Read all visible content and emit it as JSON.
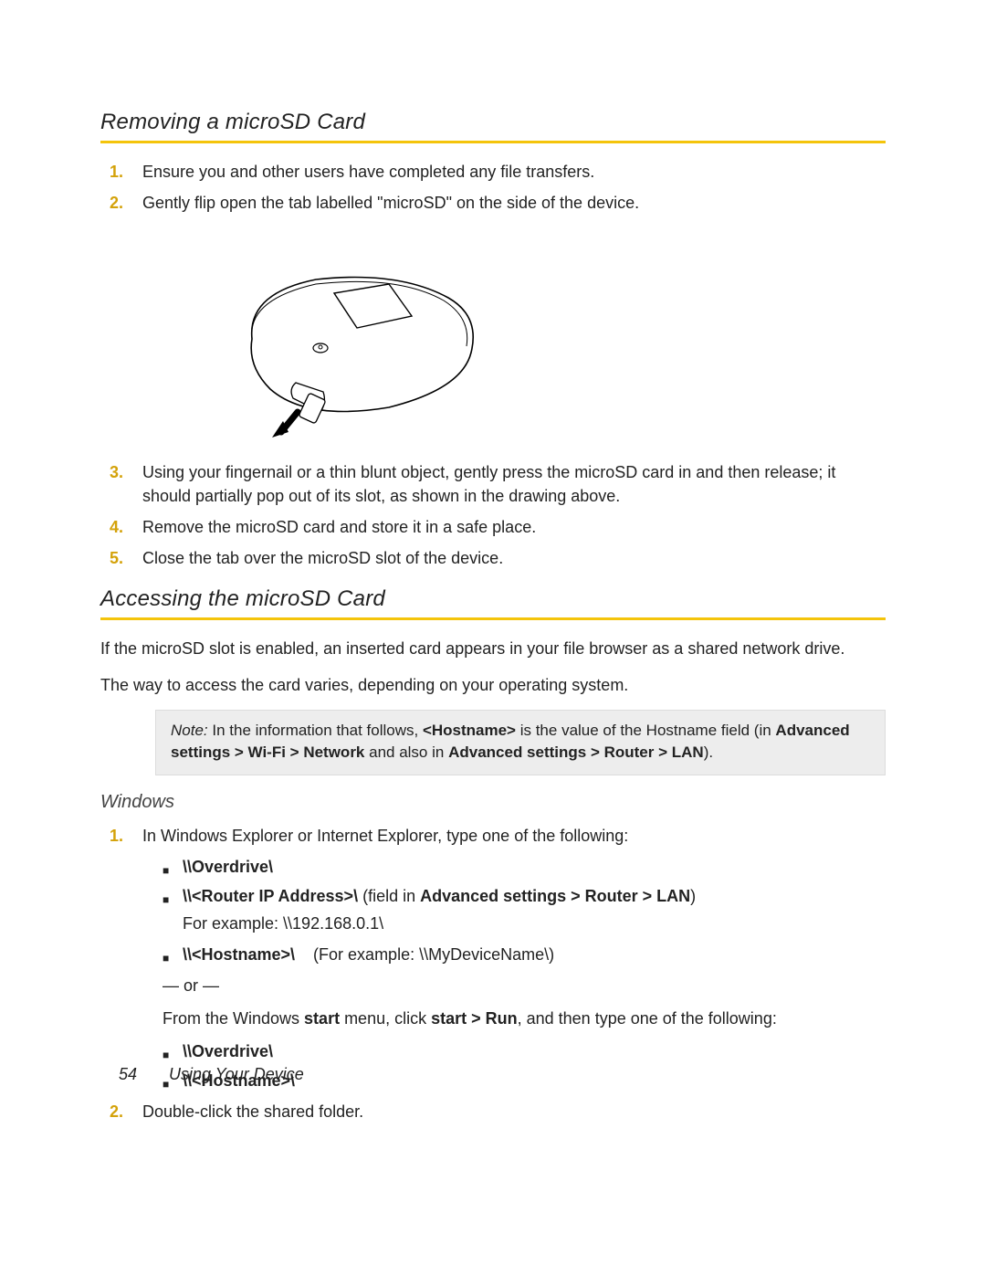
{
  "section1": {
    "title": "Removing a microSD Card",
    "steps": [
      "Ensure you and other users have completed any file transfers.",
      "Gently flip open the tab labelled \"microSD\" on the side of the device.",
      "Using your fingernail or a thin blunt object, gently press the microSD card in and then release; it should partially pop out of its slot, as shown in the drawing above.",
      "Remove the microSD card and store it in a safe place.",
      "Close the tab over the microSD slot of the device."
    ]
  },
  "section2": {
    "title": "Accessing the microSD Card",
    "intro1": "If the microSD slot is enabled, an inserted card appears in your file browser as a shared network drive.",
    "intro2": "The way to access the card varies, depending on your operating system.",
    "note_label": "Note:",
    "note_rest": " In the information that follows, ",
    "note_hostname": "<Hostname>",
    "note_mid": " is the value of the Hostname field (in ",
    "note_path1": "Advanced settings > Wi-Fi > Network",
    "note_and": " and also in ",
    "note_path2": "Advanced settings > Router > LAN",
    "note_tail": ")."
  },
  "windows": {
    "heading": "Windows",
    "step1_intro": "In Windows Explorer or Internet Explorer, type one of the following:",
    "bullet_overdrive": "\\\\Overdrive\\",
    "bullet_router_pre": "\\\\<Router IP Address>\\",
    "bullet_router_mid": " (field in ",
    "bullet_router_path": "Advanced settings > Router > LAN",
    "bullet_router_end": ")",
    "router_example": "For example: \\\\192.168.0.1\\",
    "bullet_hostname_pre": "\\\\<Hostname>\\",
    "bullet_hostname_spaces": "    (For example: \\\\MyDeviceName\\)",
    "or_line": "— or —",
    "run_pre": "From the Windows ",
    "run_start": "start",
    "run_mid": " menu, click ",
    "run_click": "start > Run",
    "run_rest": ", and then type one of the following:",
    "bullet2_overdrive": "\\\\Overdrive\\",
    "bullet2_hostname": "\\\\<Hostname>\\",
    "step2": "Double-click the shared folder."
  },
  "footer": {
    "page_number": "54",
    "chapter": "Using Your Device"
  }
}
